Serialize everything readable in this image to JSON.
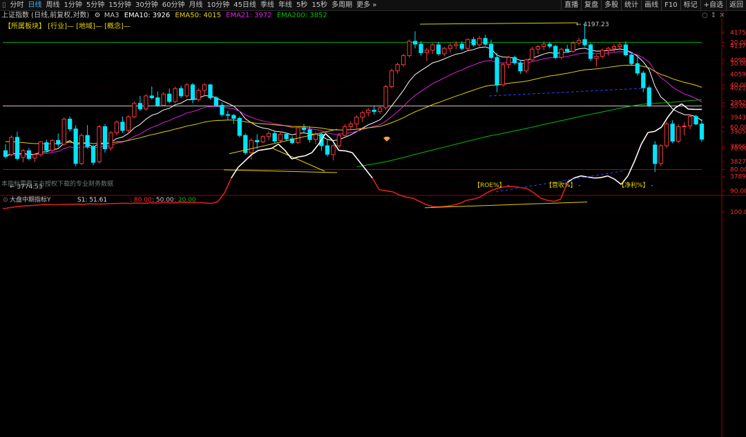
{
  "toolbar": {
    "items": [
      "分时",
      "日线",
      "周线",
      "1分钟",
      "5分钟",
      "15分钟",
      "30分钟",
      "60分钟",
      "月线",
      "10分钟",
      "45日线",
      "季线",
      "年线",
      "5秒",
      "15秒",
      "多周期",
      "更多 »"
    ],
    "active_index": 1,
    "right_items": [
      "直播",
      "复盘",
      "多股",
      "统计",
      "画线",
      "F10",
      "标记",
      "+自选",
      "返回"
    ]
  },
  "info": {
    "title": "上证指数 (日线,前复权,对数)",
    "ma3_label": "MA3",
    "ema10": "EMA10: 3926",
    "ema50": "EMA50: 4015",
    "ema21": "EMA21: 3972",
    "ema200": "EMA200: 3852",
    "colors": {
      "ema10": "#ffffff",
      "ema50": "#e8d200",
      "ema21": "#e020e0",
      "ema200": "#00c000"
    }
  },
  "sector_row": "【所属板块】 [行业]— [地域]— [概念]—",
  "price_panel": {
    "y_axis_labels": [
      "4175",
      "4137",
      "4098",
      "4059",
      "4021",
      "3982",
      "3943",
      "3905",
      "3866",
      "3827",
      "3789"
    ],
    "high_label": "4197.23",
    "low_label": "3774.53",
    "note": "本指标需要三方授权下载的专业财务数据",
    "fin_labels": [
      "【ROE%】 -",
      "【营收%】 -",
      "【净利%】 -"
    ],
    "colors": {
      "up": "#ff3b3b",
      "down": "#00e5ff",
      "axis": "#ff3030",
      "grid": "#8b0000"
    }
  },
  "indicator_panel": {
    "title": "大盘中期指标Y",
    "s1": "S1: 51.61",
    "levels": [
      {
        "text": ": 80.00",
        "color": "#ff3030"
      },
      {
        "text": ": 50.00",
        "color": "#c8c8c8"
      },
      {
        "text": ": 20.00",
        "color": "#00c000"
      }
    ],
    "y_axis_labels": [
      "100.0",
      "90.00",
      "80.00",
      "70.00",
      "60.00",
      "50.00",
      "40.00",
      "30.00",
      "20.00"
    ]
  },
  "chart_data": {
    "type": "candlestick",
    "price_range": [
      3760,
      4200
    ],
    "candles": [
      [
        3855,
        3872,
        3835,
        3840
      ],
      [
        3845,
        3895,
        3840,
        3890
      ],
      [
        3890,
        3905,
        3830,
        3835
      ],
      [
        3838,
        3860,
        3825,
        3855
      ],
      [
        3855,
        3862,
        3830,
        3835
      ],
      [
        3836,
        3850,
        3826,
        3845
      ],
      [
        3845,
        3880,
        3840,
        3878
      ],
      [
        3876,
        3884,
        3850,
        3856
      ],
      [
        3856,
        3885,
        3852,
        3882
      ],
      [
        3882,
        3900,
        3865,
        3872
      ],
      [
        3872,
        3942,
        3868,
        3938
      ],
      [
        3938,
        3945,
        3905,
        3912
      ],
      [
        3912,
        3922,
        3815,
        3822
      ],
      [
        3822,
        3900,
        3818,
        3895
      ],
      [
        3895,
        3922,
        3860,
        3866
      ],
      [
        3866,
        3870,
        3818,
        3825
      ],
      [
        3826,
        3922,
        3822,
        3918
      ],
      [
        3918,
        3925,
        3850,
        3860
      ],
      [
        3862,
        3906,
        3855,
        3902
      ],
      [
        3902,
        3935,
        3895,
        3930
      ],
      [
        3930,
        3945,
        3902,
        3908
      ],
      [
        3908,
        3948,
        3898,
        3944
      ],
      [
        3944,
        3985,
        3940,
        3980
      ],
      [
        3980,
        4000,
        3960,
        3965
      ],
      [
        3965,
        4005,
        3960,
        4000
      ],
      [
        4000,
        4025,
        3990,
        3995
      ],
      [
        3995,
        4012,
        3970,
        3975
      ],
      [
        3975,
        4010,
        3972,
        4005
      ],
      [
        4005,
        4020,
        3980,
        3985
      ],
      [
        3985,
        4025,
        3980,
        4020
      ],
      [
        4020,
        4028,
        3995,
        4000
      ],
      [
        4000,
        4035,
        3995,
        4030
      ],
      [
        4030,
        4035,
        3980,
        3990
      ],
      [
        3990,
        4020,
        3985,
        4015
      ],
      [
        4015,
        4035,
        4000,
        4030
      ],
      [
        4030,
        4032,
        3990,
        3995
      ],
      [
        3995,
        4000,
        3970,
        3975
      ],
      [
        3975,
        3982,
        3945,
        3950
      ],
      [
        3950,
        3960,
        3935,
        3948
      ],
      [
        3948,
        3952,
        3925,
        3940
      ],
      [
        3940,
        3945,
        3890,
        3895
      ],
      [
        3895,
        3900,
        3845,
        3850
      ],
      [
        3850,
        3888,
        3832,
        3882
      ],
      [
        3882,
        3898,
        3860,
        3878
      ],
      [
        3878,
        3895,
        3875,
        3892
      ],
      [
        3892,
        3906,
        3882,
        3900
      ],
      [
        3900,
        3905,
        3875,
        3880
      ],
      [
        3882,
        3906,
        3875,
        3898
      ],
      [
        3898,
        3902,
        3880,
        3886
      ],
      [
        3886,
        3893,
        3872,
        3876
      ],
      [
        3876,
        3918,
        3872,
        3915
      ],
      [
        3915,
        3925,
        3900,
        3910
      ],
      [
        3910,
        3920,
        3876,
        3884
      ],
      [
        3884,
        3905,
        3872,
        3898
      ],
      [
        3898,
        3902,
        3855,
        3868
      ],
      [
        3868,
        3885,
        3840,
        3846
      ],
      [
        3845,
        3872,
        3830,
        3868
      ],
      [
        3868,
        3902,
        3862,
        3895
      ],
      [
        3895,
        3925,
        3890,
        3918
      ],
      [
        3918,
        3932,
        3908,
        3925
      ],
      [
        3925,
        3948,
        3912,
        3943
      ],
      [
        3943,
        3960,
        3930,
        3955
      ],
      [
        3955,
        3968,
        3945,
        3962
      ],
      [
        3962,
        3972,
        3950,
        3958
      ],
      [
        3958,
        3975,
        3952,
        3968
      ],
      [
        3968,
        4030,
        3962,
        4025
      ],
      [
        4025,
        4075,
        4020,
        4068
      ],
      [
        4068,
        4090,
        4060,
        4085
      ],
      [
        4085,
        4115,
        4080,
        4110
      ],
      [
        4110,
        4155,
        4105,
        4150
      ],
      [
        4150,
        4178,
        4130,
        4142
      ],
      [
        4142,
        4150,
        4110,
        4118
      ],
      [
        4118,
        4132,
        4095,
        4125
      ],
      [
        4125,
        4145,
        4115,
        4140
      ],
      [
        4140,
        4148,
        4110,
        4115
      ],
      [
        4115,
        4135,
        4108,
        4130
      ],
      [
        4130,
        4145,
        4118,
        4138
      ],
      [
        4138,
        4150,
        4128,
        4142
      ],
      [
        4142,
        4150,
        4125,
        4130
      ],
      [
        4130,
        4158,
        4125,
        4155
      ],
      [
        4155,
        4162,
        4135,
        4140
      ],
      [
        4140,
        4165,
        4135,
        4158
      ],
      [
        4158,
        4168,
        4138,
        4142
      ],
      [
        4142,
        4155,
        4100,
        4105
      ],
      [
        4105,
        4118,
        4010,
        4030
      ],
      [
        4030,
        4090,
        4025,
        4085
      ],
      [
        4085,
        4110,
        4075,
        4105
      ],
      [
        4105,
        4110,
        4085,
        4090
      ],
      [
        4090,
        4098,
        4060,
        4068
      ],
      [
        4068,
        4102,
        4062,
        4098
      ],
      [
        4098,
        4135,
        4095,
        4128
      ],
      [
        4128,
        4140,
        4115,
        4135
      ],
      [
        4135,
        4150,
        4125,
        4142
      ],
      [
        4142,
        4148,
        4130,
        4136
      ],
      [
        4136,
        4140,
        4100,
        4105
      ],
      [
        4105,
        4132,
        4100,
        4128
      ],
      [
        4128,
        4140,
        4118,
        4122
      ],
      [
        4122,
        4150,
        4118,
        4145
      ],
      [
        4145,
        4160,
        4138,
        4152
      ],
      [
        4155,
        4197,
        4135,
        4140
      ],
      [
        4140,
        4145,
        4095,
        4102
      ],
      [
        4102,
        4112,
        4080,
        4108
      ],
      [
        4108,
        4130,
        4102,
        4125
      ],
      [
        4125,
        4135,
        4110,
        4130
      ],
      [
        4130,
        4142,
        4120,
        4135
      ],
      [
        4135,
        4148,
        4125,
        4140
      ],
      [
        4140,
        4150,
        4108,
        4112
      ],
      [
        4112,
        4120,
        4082,
        4088
      ],
      [
        4088,
        4112,
        4055,
        4062
      ],
      [
        4062,
        4068,
        4010,
        4022
      ],
      [
        4022,
        4028,
        3970,
        3975
      ],
      [
        3870,
        3880,
        3800,
        3822
      ],
      [
        3822,
        3872,
        3815,
        3868
      ],
      [
        3868,
        3932,
        3862,
        3925
      ],
      [
        3925,
        3935,
        3875,
        3880
      ],
      [
        3880,
        3925,
        3875,
        3918
      ],
      [
        3918,
        3930,
        3895,
        3920
      ],
      [
        3920,
        3950,
        3910,
        3945
      ],
      [
        3945,
        3950,
        3922,
        3925
      ],
      [
        3925,
        3938,
        3878,
        3885
      ]
    ],
    "indicator_series": [
      98.5,
      98.0,
      97.5,
      97.2,
      97.0,
      96.8,
      96.5,
      96.5,
      96.6,
      96.5,
      96.4,
      96.3,
      96.4,
      96.1,
      96.3,
      96.2,
      96.1,
      96.0,
      95.9,
      96.0,
      95.8,
      95.9,
      95.7,
      95.8,
      95.6,
      95.7,
      95.6,
      95.5,
      95.6,
      95.6,
      95.7,
      96.0,
      95.2,
      91.0,
      84.0,
      79.0,
      76.0,
      73.0,
      71.0,
      70.5,
      70.0,
      68.0,
      71.0,
      75.0,
      74.0,
      73.5,
      72.0,
      68.0,
      63.0,
      66.0,
      71.0,
      71.2,
      72.0,
      76.0,
      80.0,
      84.0,
      89.5,
      90.0,
      90.5,
      92.0,
      93.0,
      93.5,
      95.0,
      96.5,
      97.5,
      97.6,
      97.3,
      96.8,
      96.0,
      94.5,
      94.0,
      93.0,
      91.0,
      89.5,
      88.5,
      88.0,
      88.0,
      88.5,
      89.0,
      91.0,
      93.5,
      94.5,
      95.0,
      94.0,
      86.0,
      84.0,
      83.0,
      83.5,
      84.0,
      83.8,
      83.0,
      84.5,
      87.0,
      83.0,
      76.0,
      68.0,
      62.5,
      62.0,
      60.0,
      55.0,
      51.0,
      49.0,
      51.5,
      51.6,
      51.6
    ]
  }
}
